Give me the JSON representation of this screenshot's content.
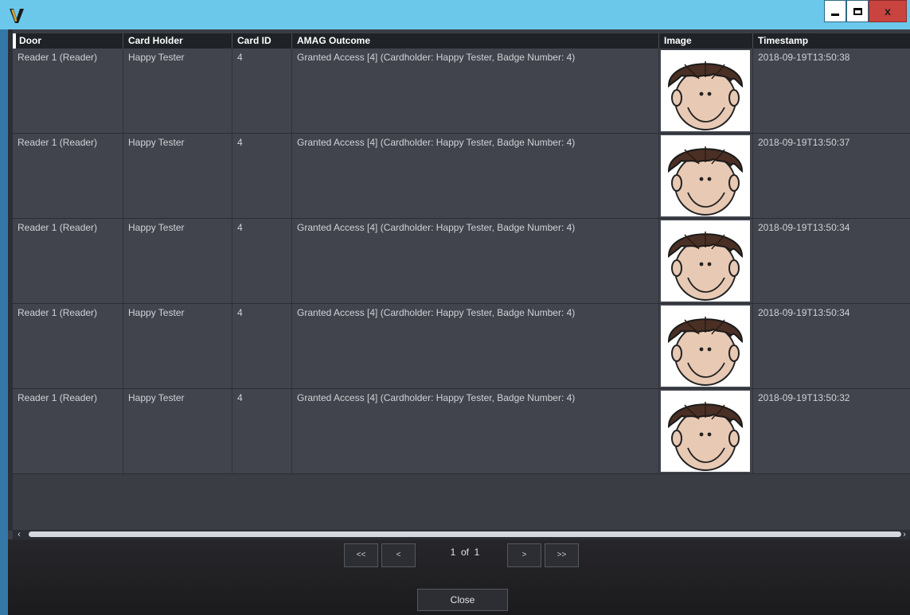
{
  "window": {
    "minimize_label": "",
    "maximize_label": "",
    "close_label": "x"
  },
  "table": {
    "columns": [
      "Door",
      "Card Holder",
      "Card ID",
      "AMAG Outcome",
      "Image",
      "Timestamp"
    ],
    "rows": [
      {
        "door": "Reader 1 (Reader)",
        "card_holder": "Happy Tester",
        "card_id": "4",
        "outcome": "Granted Access [4] (Cardholder: Happy Tester, Badge Number: 4)",
        "image": "cartoon-face-image",
        "timestamp": "2018-09-19T13:50:38"
      },
      {
        "door": "Reader 1 (Reader)",
        "card_holder": "Happy Tester",
        "card_id": "4",
        "outcome": "Granted Access [4] (Cardholder: Happy Tester, Badge Number: 4)",
        "image": "cartoon-face-image",
        "timestamp": "2018-09-19T13:50:37"
      },
      {
        "door": "Reader 1 (Reader)",
        "card_holder": "Happy Tester",
        "card_id": "4",
        "outcome": "Granted Access [4] (Cardholder: Happy Tester, Badge Number: 4)",
        "image": "cartoon-face-image",
        "timestamp": "2018-09-19T13:50:34"
      },
      {
        "door": "Reader 1 (Reader)",
        "card_holder": "Happy Tester",
        "card_id": "4",
        "outcome": "Granted Access [4] (Cardholder: Happy Tester, Badge Number: 4)",
        "image": "cartoon-face-image",
        "timestamp": "2018-09-19T13:50:34"
      },
      {
        "door": "Reader 1 (Reader)",
        "card_holder": "Happy Tester",
        "card_id": "4",
        "outcome": "Granted Access [4] (Cardholder: Happy Tester, Badge Number: 4)",
        "image": "cartoon-face-image",
        "timestamp": "2018-09-19T13:50:32"
      }
    ]
  },
  "pager": {
    "first_label": "<<",
    "prev_label": "<",
    "page_info": "1  of  1",
    "next_label": ">",
    "last_label": ">>"
  },
  "footer": {
    "close_label": "Close"
  },
  "colors": {
    "titlebar": "#6bc8ea",
    "header_bg": "#1f2226",
    "row_bg": "#41444c",
    "close_button": "#c9433f"
  }
}
